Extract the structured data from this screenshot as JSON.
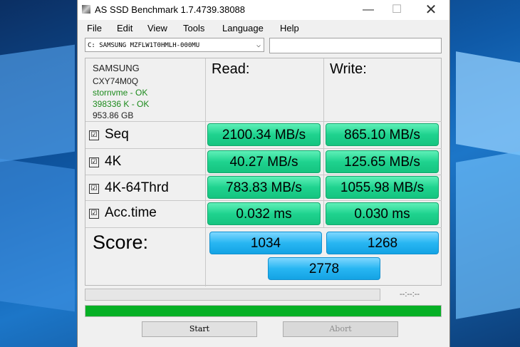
{
  "window": {
    "title": "AS SSD Benchmark 1.7.4739.38088",
    "minimize": "—",
    "maximize": "☐",
    "close": "✕"
  },
  "menu": [
    "File",
    "Edit",
    "View",
    "Tools",
    "Language",
    "Help"
  ],
  "drive": {
    "selected": "C: SAMSUNG MZFLW1T0HMLH-000MU",
    "arrow": "⌵"
  },
  "device_info": {
    "vendor": "SAMSUNG",
    "firmware": "CXY74M0Q",
    "driver": "stornvme - OK",
    "alignment": "398336 K - OK",
    "size": "953.86 GB"
  },
  "columns": {
    "read": "Read:",
    "write": "Write:"
  },
  "rows": [
    {
      "label": "Seq",
      "read": "2100.34 MB/s",
      "write": "865.10 MB/s",
      "checked": "☑"
    },
    {
      "label": "4K",
      "read": "40.27 MB/s",
      "write": "125.65 MB/s",
      "checked": "☑"
    },
    {
      "label": "4K-64Thrd",
      "read": "783.83 MB/s",
      "write": "1055.98 MB/s",
      "checked": "☑"
    },
    {
      "label": "Acc.time",
      "read": "0.032 ms",
      "write": "0.030 ms",
      "checked": "☑"
    }
  ],
  "score": {
    "label": "Score:",
    "read": "1034",
    "write": "1268",
    "total": "2778"
  },
  "status": {
    "timer": "--:--:--",
    "progress_fraction": 1.0
  },
  "buttons": {
    "start": "Start",
    "abort": "Abort"
  },
  "colors": {
    "result_green": "#1fd38f",
    "score_blue": "#28b6f2",
    "progress_green": "#06b025",
    "status_ok": "#1c8a1c"
  }
}
